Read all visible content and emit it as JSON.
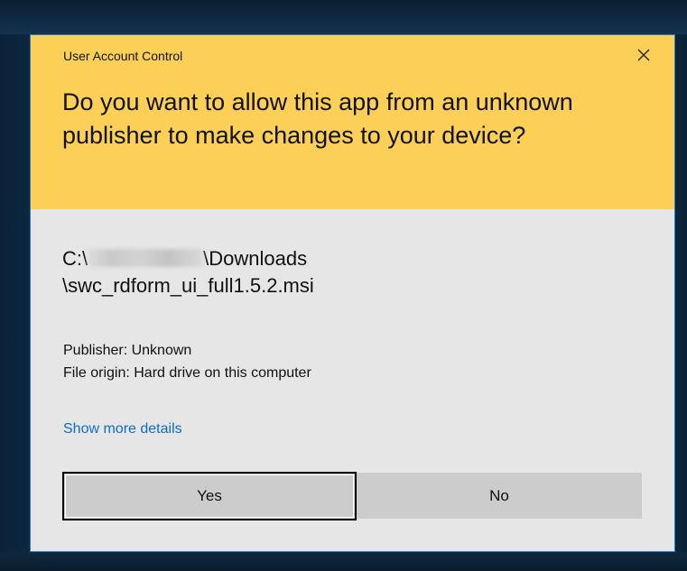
{
  "dialog": {
    "app_title": "User Account Control",
    "question": "Do you want to allow this app from an unknown publisher to make changes to your device?",
    "path_prefix": "C:\\",
    "path_suffix": "\\Downloads",
    "path_line2": "\\swc_rdform_ui_full1.5.2.msi",
    "publisher": "Publisher: Unknown",
    "file_origin": "File origin: Hard drive on this computer",
    "details_link": "Show more details",
    "yes_label": "Yes",
    "no_label": "No",
    "close_icon": "close-icon"
  },
  "colors": {
    "header_bg": "#fcd057",
    "body_bg": "#e6e6e6",
    "link": "#0f6cc6",
    "button_bg": "#cccccc",
    "dialog_border": "#2b78c6"
  }
}
